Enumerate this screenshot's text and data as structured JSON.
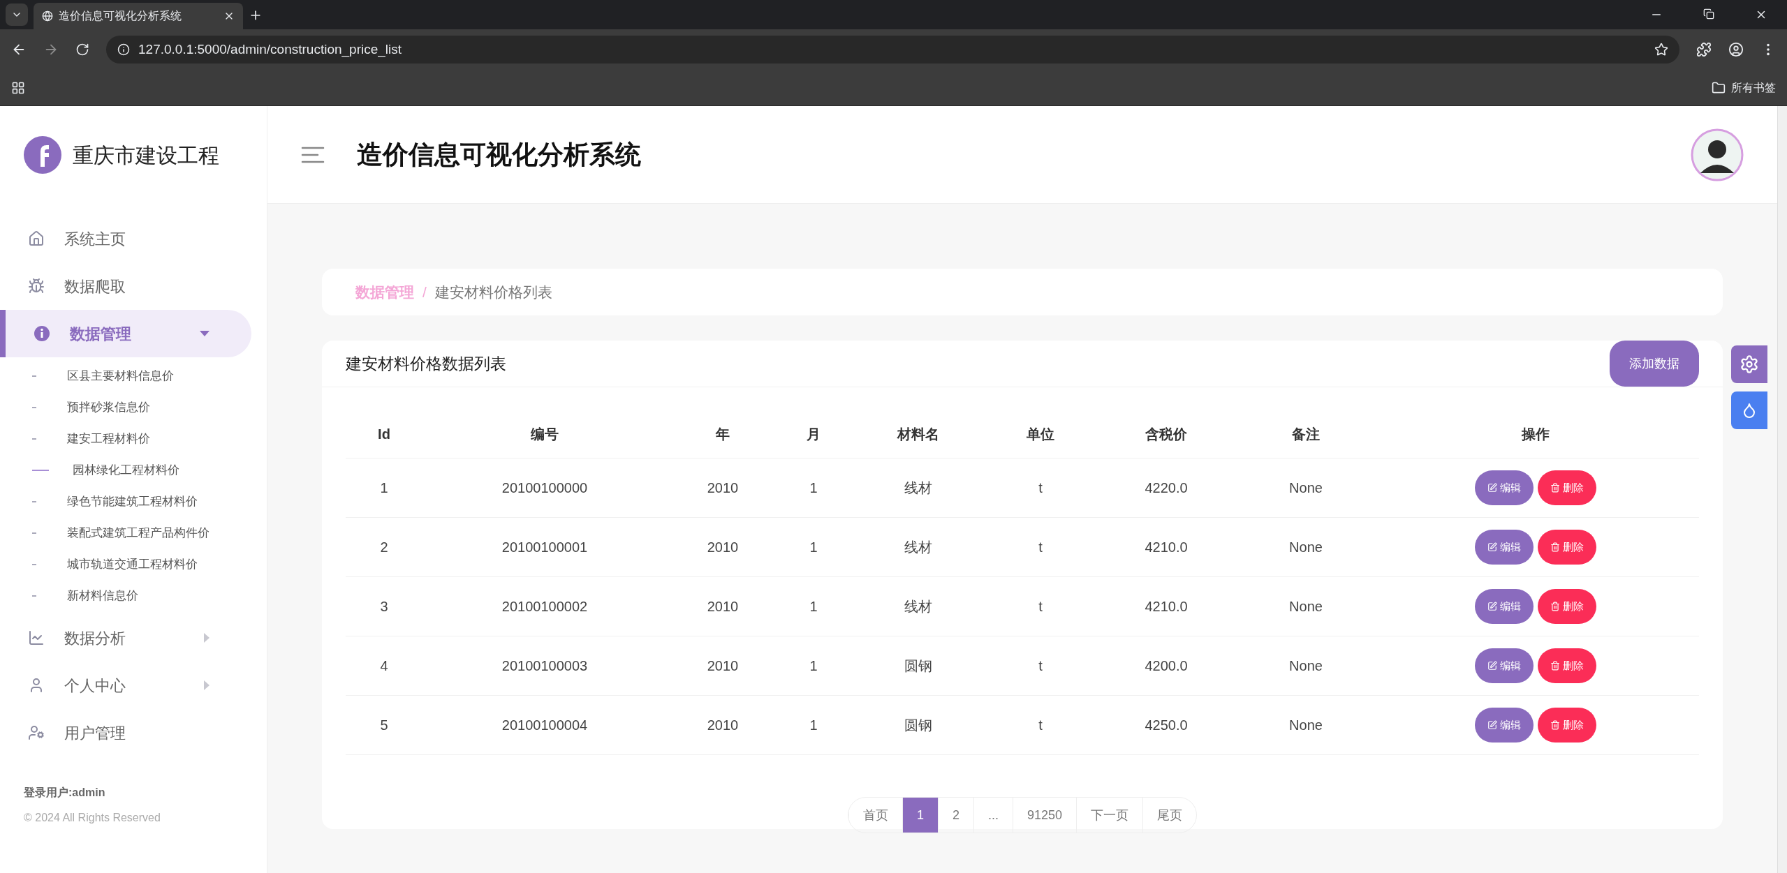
{
  "browser": {
    "tab_title": "造价信息可视化分析系统",
    "url": "127.0.0.1:5000/admin/construction_price_list",
    "bookmarks_label": "所有书签"
  },
  "sidebar": {
    "brand": "重庆市建设工程",
    "items": [
      {
        "label": "系统主页",
        "selected": false
      },
      {
        "label": "数据爬取",
        "selected": false
      },
      {
        "label": "数据管理",
        "selected": true,
        "expanded": true,
        "children": [
          {
            "label": "区县主要材料信息价",
            "hovered": false
          },
          {
            "label": "预拌砂浆信息价",
            "hovered": false
          },
          {
            "label": "建安工程材料价",
            "hovered": false
          },
          {
            "label": "园林绿化工程材料价",
            "hovered": true
          },
          {
            "label": "绿色节能建筑工程材料价",
            "hovered": false
          },
          {
            "label": "装配式建筑工程产品构件价",
            "hovered": false
          },
          {
            "label": "城市轨道交通工程材料价",
            "hovered": false
          },
          {
            "label": "新材料信息价",
            "hovered": false
          }
        ]
      },
      {
        "label": "数据分析",
        "selected": false,
        "expanded": false
      },
      {
        "label": "个人中心",
        "selected": false,
        "expanded": false
      },
      {
        "label": "用户管理",
        "selected": false
      }
    ],
    "login_user": "登录用户:admin",
    "copyright": "© 2024 All Rights Reserved"
  },
  "header": {
    "title": "造价信息可视化分析系统"
  },
  "breadcrumb": {
    "items": [
      "数据管理",
      "建安材料价格列表"
    ],
    "separator": "/"
  },
  "card": {
    "title": "建安材料价格数据列表",
    "add_button": "添加数据",
    "table": {
      "columns": [
        "Id",
        "编号",
        "年",
        "月",
        "材料名",
        "单位",
        "含税价",
        "备注",
        "操作"
      ],
      "rows": [
        {
          "cells": [
            "1",
            "20100100000",
            "2010",
            "1",
            "线材",
            "t",
            "4220.0",
            "None"
          ],
          "edit": "编辑",
          "delete": "删除"
        },
        {
          "cells": [
            "2",
            "20100100001",
            "2010",
            "1",
            "线材",
            "t",
            "4210.0",
            "None"
          ],
          "edit": "编辑",
          "delete": "删除"
        },
        {
          "cells": [
            "3",
            "20100100002",
            "2010",
            "1",
            "线材",
            "t",
            "4210.0",
            "None"
          ],
          "edit": "编辑",
          "delete": "删除"
        },
        {
          "cells": [
            "4",
            "20100100003",
            "2010",
            "1",
            "圆钢",
            "t",
            "4200.0",
            "None"
          ],
          "edit": "编辑",
          "delete": "删除"
        },
        {
          "cells": [
            "5",
            "20100100004",
            "2010",
            "1",
            "圆钢",
            "t",
            "4250.0",
            "None"
          ],
          "edit": "编辑",
          "delete": "删除"
        }
      ]
    },
    "pagination": [
      {
        "label": "首页",
        "selected": false
      },
      {
        "label": "1",
        "selected": true
      },
      {
        "label": "2",
        "selected": false
      },
      {
        "label": "...",
        "selected": false
      },
      {
        "label": "91250",
        "selected": false
      },
      {
        "label": "下一页",
        "selected": false
      },
      {
        "label": "尾页",
        "selected": false
      }
    ]
  }
}
